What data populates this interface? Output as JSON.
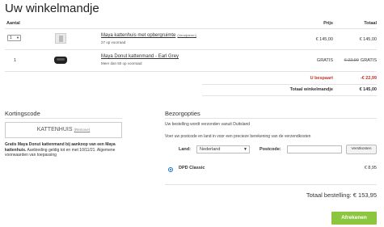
{
  "page": {
    "title": "Uw winkelmandje"
  },
  "table": {
    "headers": {
      "quantity": "Aantal",
      "price": "Prijs",
      "total": "Totaal"
    },
    "items": [
      {
        "quantity": "1",
        "name": "Maya kattenhuis met opbergruimte",
        "badge": "(Verwijderen)",
        "subtitle": "27 op voorraad",
        "price": "€ 145,00",
        "total": "€ 145,00",
        "image_icon": "product-image-icon"
      },
      {
        "quantity": "1",
        "name": "Maya Donut kattenmand - Earl Grey",
        "subtitle": "Meer dan 50 op voorraad",
        "price": "GRATIS",
        "old_total": "€ 22,99",
        "total": "GRATIS",
        "image_icon": "product-image-icon"
      }
    ],
    "summary": {
      "saved_label": "U bespaart",
      "saved_value": "-€ 22,99",
      "cart_total_label": "Totaal winkelmandje",
      "cart_total_value": "€ 145,00"
    }
  },
  "coupon": {
    "section_title": "Kortingscode",
    "code": "KATTENHUIS",
    "remove_label": "(Remove)",
    "promo_bold": "Gratis Maya Donut kattenmand bij aankoop van een Maya kattenhuis.",
    "promo_text": "Aanbieding geldig tot en met 10/11/21. Algemene voorwaarden van toepassing"
  },
  "shipping": {
    "section_title": "Bezorgopties",
    "from_text": "Uw bestelling wordt verzonden vanuit Duitsland",
    "instruction": "Voer uw postcode en land in voor een precieze berekening van de verzendkosten",
    "country_label": "Land:",
    "country_value": "Nederland",
    "postcode_label": "Postcode:",
    "postcode_value": "",
    "calc_button": "Verstkosten",
    "option_name": "DPD Classic",
    "option_price": "€ 8,95"
  },
  "order": {
    "grand_total_label": "Totaal bestelling:",
    "grand_total_value": "€ 153,95",
    "checkout_button": "Afrekenen"
  },
  "colors": {
    "accent_green": "#8cc63f",
    "saving_red": "#c0392b",
    "radio_blue": "#1a6fd1"
  }
}
